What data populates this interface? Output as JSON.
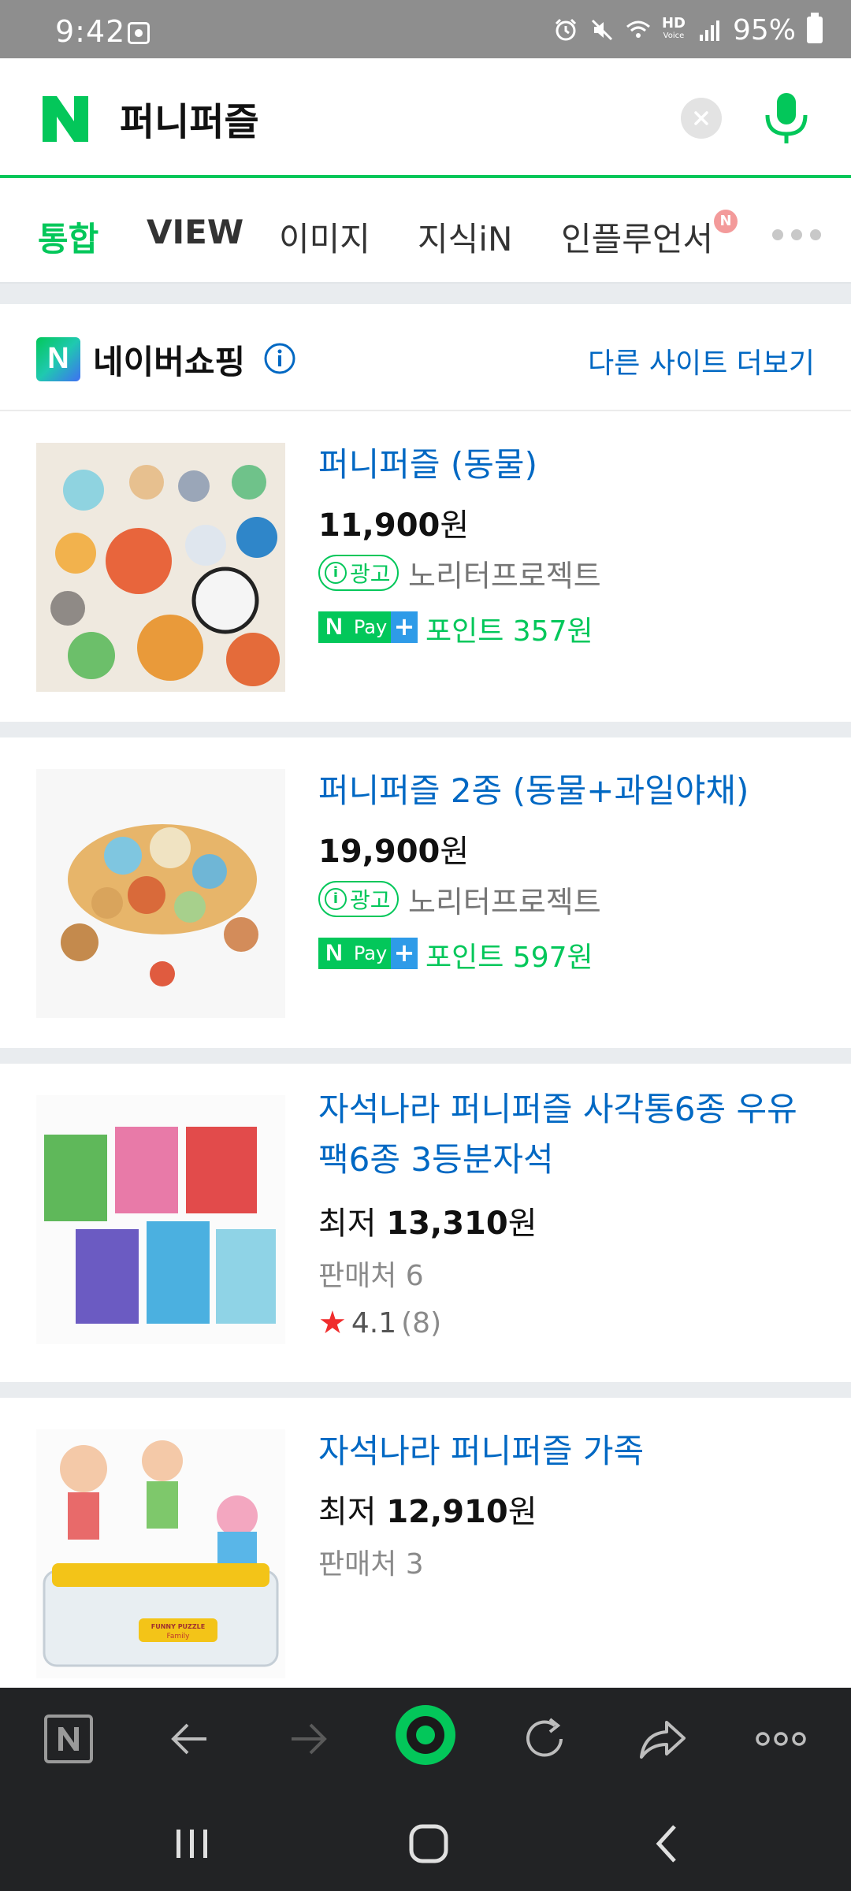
{
  "status_bar": {
    "time": "9:42",
    "hd_label": "HD",
    "hd_sub": "Voice",
    "battery": "95%"
  },
  "search": {
    "query": "퍼니퍼즐"
  },
  "tabs": [
    {
      "label": "통합",
      "active": true
    },
    {
      "label": "VIEW"
    },
    {
      "label": "이미지"
    },
    {
      "label": "지식iN"
    },
    {
      "label": "인플루언서",
      "badge": "N"
    }
  ],
  "section": {
    "logo_letter": "N",
    "title": "네이버쇼핑",
    "more_link": "다른 사이트 더보기"
  },
  "products": [
    {
      "title": "퍼니퍼즐 (동물)",
      "price": "11,900",
      "currency": "원",
      "ad_label": "광고",
      "seller": "노리터프로젝트",
      "npay_n": "N",
      "npay_label": "Pay",
      "npay_plus": "+",
      "points": "포인트 357원"
    },
    {
      "title": "퍼니퍼즐 2종 (동물+과일야채)",
      "price": "19,900",
      "currency": "원",
      "ad_label": "광고",
      "seller": "노리터프로젝트",
      "npay_n": "N",
      "npay_label": "Pay",
      "npay_plus": "+",
      "points": "포인트 597원"
    },
    {
      "title": "자석나라 퍼니퍼즐 사각통6종 우유팩6종 3등분자석",
      "price_prefix": "최저",
      "price": "13,310",
      "currency": "원",
      "sellers": "판매처 6",
      "rating": "4.1",
      "reviews": "(8)"
    },
    {
      "title": "자석나라 퍼니퍼즐 가족",
      "price_prefix": "최저",
      "price": "12,910",
      "currency": "원",
      "sellers": "판매처 3",
      "package_label": "FUNNY PUZZLE",
      "package_sub": "Family"
    }
  ],
  "colors": {
    "naver_green": "#03c75a",
    "link_blue": "#0068c3",
    "star_red": "#f02d2d",
    "toolbar_bg": "#222325"
  }
}
